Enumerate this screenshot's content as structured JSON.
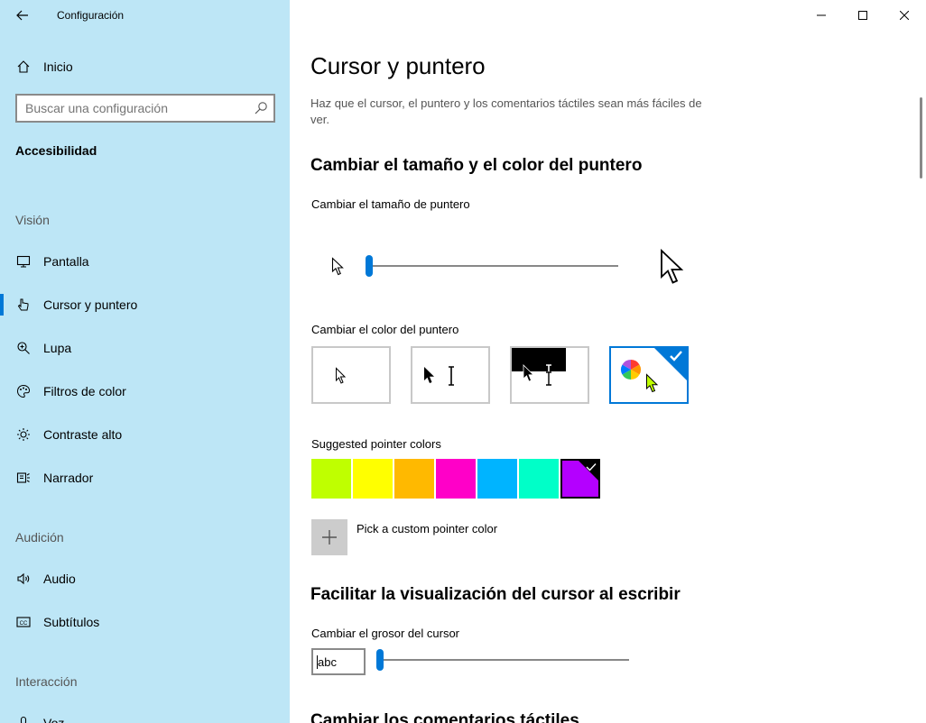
{
  "window": {
    "app_title": "Configuración",
    "controls": {
      "minimize": "minimize-icon",
      "maximize": "maximize-icon",
      "close": "close-icon"
    }
  },
  "sidebar": {
    "home_label": "Inicio",
    "search_placeholder": "Buscar una configuración",
    "current_section": "Accesibilidad",
    "groups": {
      "vision": "Visión",
      "audio": "Audición",
      "interaction": "Interacción"
    },
    "items": [
      {
        "label": "Pantalla",
        "icon": "monitor-icon"
      },
      {
        "label": "Cursor y puntero",
        "icon": "cursor-hand-icon",
        "active": true
      },
      {
        "label": "Lupa",
        "icon": "magnifier-icon"
      },
      {
        "label": "Filtros de color",
        "icon": "palette-icon"
      },
      {
        "label": "Contraste alto",
        "icon": "sun-icon"
      },
      {
        "label": "Narrador",
        "icon": "narrator-icon"
      },
      {
        "label": "Audio",
        "icon": "speaker-icon"
      },
      {
        "label": "Subtítulos",
        "icon": "cc-icon"
      },
      {
        "label": "Voz",
        "icon": "microphone-icon"
      }
    ]
  },
  "main": {
    "title": "Cursor y puntero",
    "description": "Haz que el cursor, el puntero y los comentarios táctiles sean más fáciles de ver.",
    "section_size_color": "Cambiar el tamaño y el color del puntero",
    "size_label": "Cambiar el tamaño de puntero",
    "size_value": 0.0,
    "color_label": "Cambiar el color del puntero",
    "color_options": [
      "white",
      "black",
      "inverted",
      "custom"
    ],
    "selected_color_option": "custom",
    "suggested_label": "Suggested pointer colors",
    "suggested_colors": [
      "#bfff00",
      "#ffff00",
      "#ffb900",
      "#ff00c8",
      "#00b4ff",
      "#00ffc8",
      "#b400ff"
    ],
    "selected_suggested": 6,
    "custom_color_label": "Pick a custom pointer color",
    "section_cursor": "Facilitar la visualización del cursor al escribir",
    "thickness_label": "Cambiar el grosor del cursor",
    "thickness_preview": "abc",
    "thickness_value": 0.0,
    "section_touch": "Cambiar los comentarios táctiles"
  },
  "colors": {
    "accent": "#0078d7",
    "sidebar_bg": "#bde6f6"
  }
}
